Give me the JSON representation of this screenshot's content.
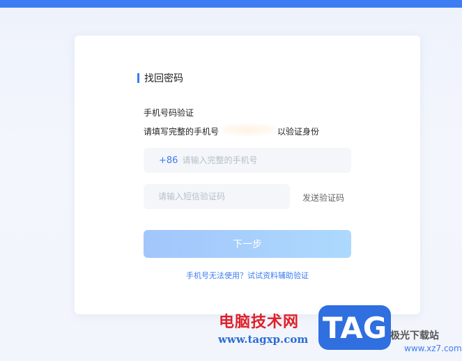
{
  "colors": {
    "accent": "#3d7cf2",
    "button_gradient_start": "#9dc3fb",
    "button_gradient_end": "#a9d7fd"
  },
  "page": {
    "title": "找回密码"
  },
  "verify": {
    "label": "手机号码验证",
    "hint_prefix": "请填写完整的手机号",
    "hint_suffix": "以验证身份"
  },
  "phone": {
    "prefix": "+86",
    "value": "",
    "placeholder": "请输入完整的手机号"
  },
  "sms": {
    "value": "",
    "placeholder": "请输入短信验证码",
    "send_label": "发送验证码"
  },
  "next_label": "下一步",
  "alt_link": "手机号无法使用？试试资料辅助验证",
  "watermark": {
    "cn": "电脑技术网",
    "url": "www.tagxp.com",
    "tag": "TAG",
    "site": "极光下载站",
    "site_url": "www.xz7.com"
  }
}
